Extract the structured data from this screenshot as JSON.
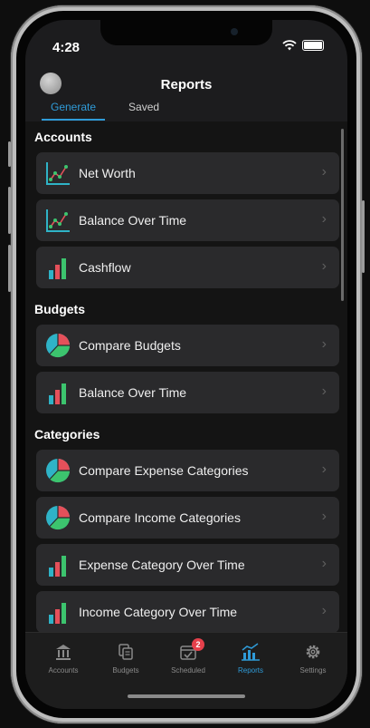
{
  "status": {
    "time": "4:28"
  },
  "header": {
    "title": "Reports",
    "tabs": [
      {
        "label": "Generate",
        "active": true
      },
      {
        "label": "Saved",
        "active": false
      }
    ]
  },
  "sections": [
    {
      "title": "Accounts",
      "items": [
        {
          "label": "Net Worth",
          "icon": "line-chart-icon"
        },
        {
          "label": "Balance Over Time",
          "icon": "line-chart-icon"
        },
        {
          "label": "Cashflow",
          "icon": "bar-chart-icon"
        }
      ]
    },
    {
      "title": "Budgets",
      "items": [
        {
          "label": "Compare Budgets",
          "icon": "pie-chart-icon"
        },
        {
          "label": "Balance Over Time",
          "icon": "bar-chart-icon"
        }
      ]
    },
    {
      "title": "Categories",
      "items": [
        {
          "label": "Compare Expense Categories",
          "icon": "pie-chart-icon"
        },
        {
          "label": "Compare Income Categories",
          "icon": "pie-chart-icon"
        },
        {
          "label": "Expense Category Over Time",
          "icon": "bar-chart-icon"
        },
        {
          "label": "Income Category Over Time",
          "icon": "bar-chart-icon"
        }
      ]
    }
  ],
  "tabbar": {
    "items": [
      {
        "label": "Accounts",
        "icon": "bank-icon"
      },
      {
        "label": "Budgets",
        "icon": "documents-icon"
      },
      {
        "label": "Scheduled",
        "icon": "calendar-check-icon",
        "badge": "2"
      },
      {
        "label": "Reports",
        "icon": "reports-chart-icon",
        "active": true
      },
      {
        "label": "Settings",
        "icon": "gear-icon"
      }
    ]
  },
  "colors": {
    "accent": "#2f9bd8",
    "badge": "#e5404b",
    "green": "#3cc46e",
    "red": "#e5505a",
    "teal": "#2fb3c7"
  }
}
